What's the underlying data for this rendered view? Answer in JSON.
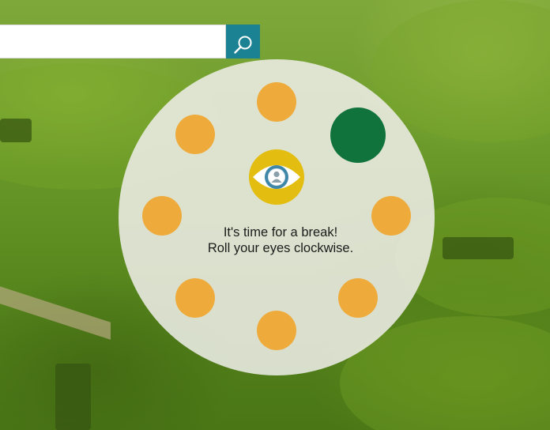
{
  "search": {
    "value": "",
    "placeholder": "",
    "button_icon": "search-icon",
    "accent_color": "#1b8294"
  },
  "break_reminder": {
    "title": "It's time for a break!",
    "instruction": "Roll your eyes clockwise.",
    "center_icon": "eye-icon",
    "dot_color": "#eeab3c",
    "active_dot_color": "#10733c",
    "active_dot_index": 1,
    "dot_count": 8
  }
}
